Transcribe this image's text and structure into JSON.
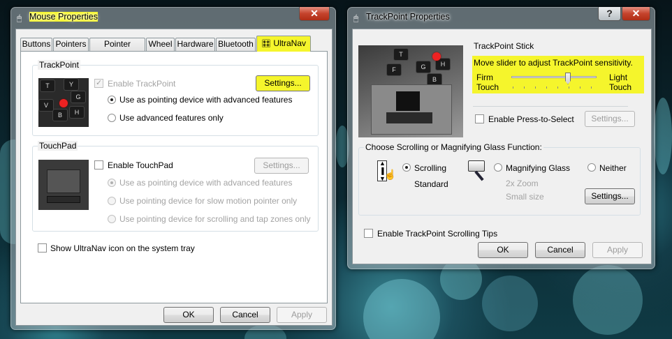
{
  "mouse_window": {
    "title": "Mouse Properties",
    "tabs": [
      {
        "label": "Buttons"
      },
      {
        "label": "Pointers"
      },
      {
        "label": "Pointer Options"
      },
      {
        "label": "Wheel"
      },
      {
        "label": "Hardware"
      },
      {
        "label": "Bluetooth"
      },
      {
        "label": "UltraNav"
      }
    ],
    "trackpoint": {
      "group_title": "TrackPoint",
      "enable_label": "Enable TrackPoint",
      "settings_label": "Settings...",
      "option_advanced": "Use as pointing device with advanced features",
      "option_features_only": "Use advanced features only"
    },
    "touchpad": {
      "group_title": "TouchPad",
      "enable_label": "Enable TouchPad",
      "settings_label": "Settings...",
      "option_advanced": "Use as pointing device with advanced features",
      "option_slow": "Use pointing device for slow motion pointer only",
      "option_scroll": "Use pointing device for scrolling and tap zones only"
    },
    "tray_label": "Show UltraNav icon on the system tray",
    "ok_label": "OK",
    "cancel_label": "Cancel",
    "apply_label": "Apply"
  },
  "trackpoint_window": {
    "title": "TrackPoint Properties",
    "help_label": "?",
    "stick": {
      "group_title": "TrackPoint Stick",
      "instruction": "Move slider to adjust TrackPoint sensitivity.",
      "firm_label_1": "Firm",
      "firm_label_2": "Touch",
      "light_label_1": "Light",
      "light_label_2": "Touch",
      "sensitivity_position": 0.67,
      "press_select_label": "Enable Press-to-Select",
      "settings_label": "Settings..."
    },
    "scroll": {
      "group_title": "Choose Scrolling or Magnifying Glass Function:",
      "scrolling_label": "Scrolling",
      "standard_label": "Standard",
      "magnify_label": "Magnifying Glass",
      "zoom_label": "2x Zoom",
      "size_label": "Small size",
      "neither_label": "Neither",
      "settings_label": "Settings..."
    },
    "tips_label": "Enable TrackPoint Scrolling Tips",
    "ok_label": "OK",
    "cancel_label": "Cancel",
    "apply_label": "Apply"
  },
  "keys": [
    "T",
    "Y",
    "G",
    "H",
    "B",
    "V",
    "F"
  ],
  "colors": {
    "highlight": "#f5f52c",
    "close_button": "#c5432c"
  }
}
